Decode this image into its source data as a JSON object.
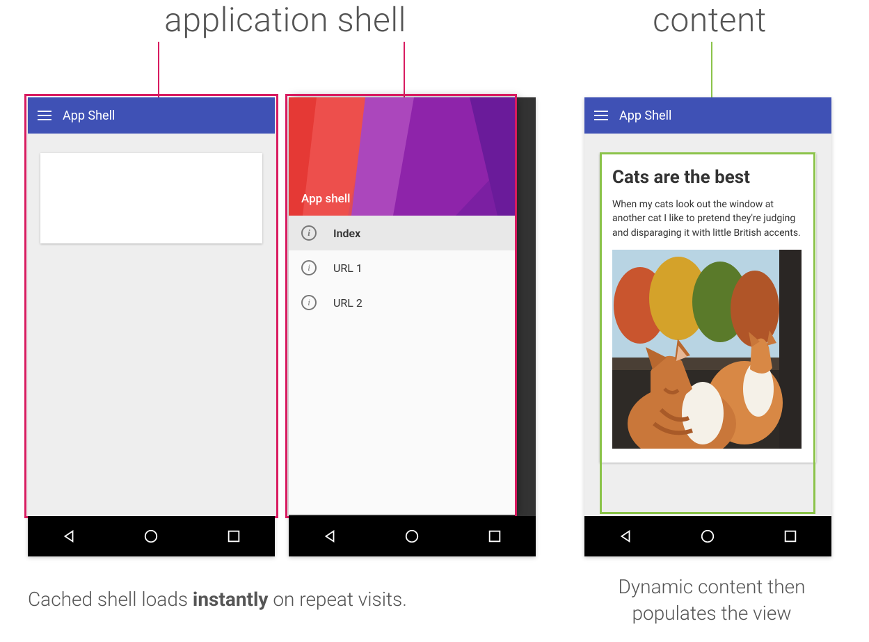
{
  "labels": {
    "shell": "application shell",
    "content": "content"
  },
  "captions": {
    "left_prefix": "Cached shell loads ",
    "left_bold": "instantly",
    "left_suffix": " on repeat visits.",
    "right": "Dynamic content then populates the view"
  },
  "appbar": {
    "title": "App Shell"
  },
  "drawer": {
    "header": "App shell",
    "items": [
      {
        "label": "Index",
        "selected": true
      },
      {
        "label": "URL 1",
        "selected": false
      },
      {
        "label": "URL 2",
        "selected": false
      }
    ]
  },
  "article": {
    "title": "Cats are the best",
    "body": "When my cats look out the window at another cat I like to pretend they're judging and disparaging it with little British accents."
  },
  "colors": {
    "primary": "#3f51b5",
    "accent_pink": "#d81b60",
    "accent_green": "#8bc34a"
  }
}
